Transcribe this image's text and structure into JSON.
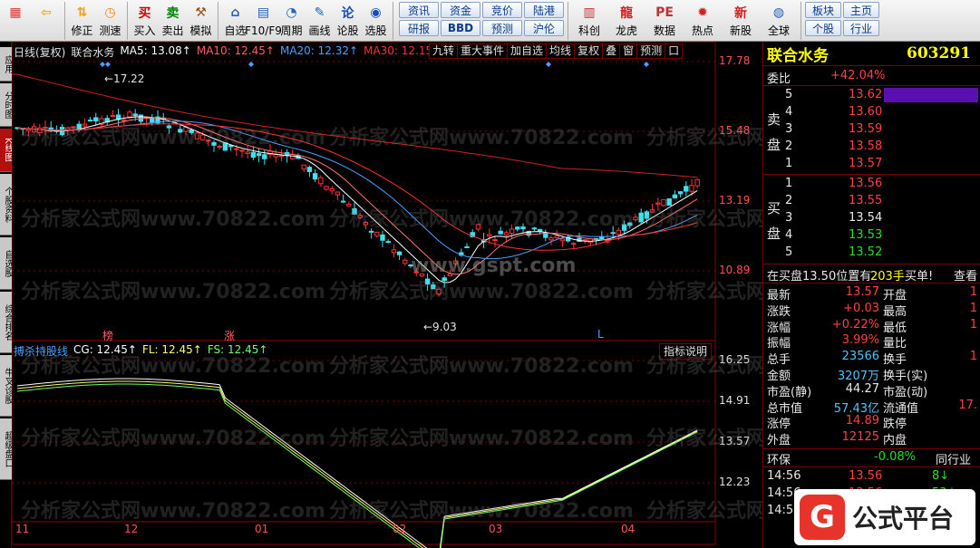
{
  "toolbar": {
    "left": [
      {
        "icon": "grid-icon",
        "label": ""
      },
      {
        "icon": "back-arrow-icon",
        "label": ""
      },
      {
        "icon": "fix-icon",
        "label": "修正"
      },
      {
        "icon": "clock-icon",
        "label": "测速"
      },
      {
        "icon": "buy-icon",
        "label": "买入",
        "ch": "买"
      },
      {
        "icon": "sell-icon",
        "label": "卖出",
        "ch": "卖"
      },
      {
        "icon": "hammer-icon",
        "label": "模拟"
      },
      {
        "icon": "home-icon",
        "label": "自选"
      },
      {
        "icon": "f10-icon",
        "label": "F10/F9"
      },
      {
        "icon": "period-icon",
        "label": "周期"
      },
      {
        "icon": "pen-icon",
        "label": "画线"
      },
      {
        "icon": "talk-icon",
        "label": "论股",
        "ch": "论"
      },
      {
        "icon": "pick-icon",
        "label": "选股"
      }
    ],
    "buttons_top": [
      "资讯",
      "资金",
      "竞价",
      "陆港"
    ],
    "buttons_bottom": [
      "研报",
      "BBD",
      "预测",
      "沪伦"
    ],
    "right": [
      {
        "icon": "chart-small-icon",
        "label": "科创"
      },
      {
        "icon": "dragon-icon",
        "label": "龙虎"
      },
      {
        "icon": "pe-icon",
        "label": "数据",
        "ch": "PE"
      },
      {
        "icon": "hot-icon",
        "label": "热点"
      },
      {
        "icon": "newstock-icon",
        "label": "新股",
        "ch": "新"
      },
      {
        "icon": "globe-icon",
        "label": "全球"
      }
    ],
    "far_right": [
      [
        "板块",
        "主页"
      ],
      [
        "个股",
        "行业"
      ]
    ]
  },
  "left_tabs": [
    "应用",
    "分时图",
    "K线图",
    "个股资料",
    "自选股",
    "综合排名",
    "牛叉诊股",
    "超级盘口"
  ],
  "chart": {
    "header": {
      "mode": "日线(复权)",
      "name": "联合水务",
      "ma5": "MA5: 13.08↑",
      "ma10": "MA10: 12.45↑",
      "ma20": "MA20: 12.32↑",
      "ma30": "MA30: 12.15↑",
      "more": "M"
    },
    "tabs": [
      "九转",
      "重大事件",
      "加自选",
      "均线",
      "复权",
      "叠",
      "窗",
      "预测",
      "口"
    ],
    "price_axis": [
      "17.78",
      "15.48",
      "13.19",
      "10.89"
    ],
    "high_label": "17.22",
    "low_label": "9.03",
    "markers": [
      "榜",
      "涨",
      "L"
    ],
    "indicator": {
      "name": "搏杀持股线",
      "cg": "CG: 12.45↑",
      "fl": "FL: 12.45↑",
      "fs": "FS: 12.45↑",
      "btn": "指标说明",
      "axis": [
        "16.25",
        "14.91",
        "13.57",
        "12.23"
      ]
    },
    "dates": [
      "11",
      "12",
      "01",
      "02",
      "03",
      "04"
    ],
    "watermarks": [
      "分析家公式网www.70822.com",
      "www.gspt.com"
    ]
  },
  "quote": {
    "name": "联合水务",
    "code": "603291",
    "weibi_label": "委比",
    "weibi": "+42.04%",
    "sell_label": [
      "卖",
      "盘"
    ],
    "buy_label": [
      "买",
      "盘"
    ],
    "asks": [
      {
        "lvl": "5",
        "price": "13.62"
      },
      {
        "lvl": "4",
        "price": "13.60"
      },
      {
        "lvl": "3",
        "price": "13.59"
      },
      {
        "lvl": "2",
        "price": "13.58"
      },
      {
        "lvl": "1",
        "price": "13.57"
      }
    ],
    "bids": [
      {
        "lvl": "1",
        "price": "13.56"
      },
      {
        "lvl": "2",
        "price": "13.55"
      },
      {
        "lvl": "3",
        "price": "13.54"
      },
      {
        "lvl": "4",
        "price": "13.53"
      },
      {
        "lvl": "5",
        "price": "13.52"
      }
    ],
    "order_line": {
      "text": "在买盘13.50位置有",
      "qty": "203手",
      "act": "买单!",
      "more": "查看"
    },
    "stats": [
      {
        "k": "最新",
        "v": "13.57",
        "c": "red",
        "k2": "开盘",
        "v2": "1"
      },
      {
        "k": "涨跌",
        "v": "+0.03",
        "c": "red",
        "k2": "最高",
        "v2": "1"
      },
      {
        "k": "涨幅",
        "v": "+0.22%",
        "c": "red",
        "k2": "最低",
        "v2": "1"
      },
      {
        "k": "振幅",
        "v": "3.99%",
        "c": "red",
        "k2": "量比",
        "v2": ""
      },
      {
        "k": "总手",
        "v": "23566",
        "c": "cyan",
        "k2": "换手",
        "v2": "1"
      },
      {
        "k": "金额",
        "v": "3207万",
        "c": "cyan",
        "k2": "换手(实)",
        "v2": ""
      },
      {
        "k": "市盈(静)",
        "v": "44.27",
        "c": "wht",
        "k2": "市盈(动)",
        "v2": ""
      },
      {
        "k": "总市值",
        "v": "57.43亿",
        "c": "cyan",
        "k2": "流通值",
        "v2": "17."
      },
      {
        "k": "涨停",
        "v": "14.89",
        "c": "red",
        "k2": "跌停",
        "v2": ""
      },
      {
        "k": "外盘",
        "v": "12125",
        "c": "red",
        "k2": "内盘",
        "v2": ""
      }
    ],
    "env": {
      "k": "环保",
      "v": "-0.08%",
      "k2": "同行业"
    },
    "ticks": [
      {
        "t": "14:56",
        "p": "13.56",
        "v": "8"
      },
      {
        "t": "14:56",
        "p": "13.56",
        "v": "53"
      },
      {
        "t": "14:56",
        "p": "",
        "v": ""
      }
    ]
  },
  "logo": {
    "text": "公式平台"
  }
}
